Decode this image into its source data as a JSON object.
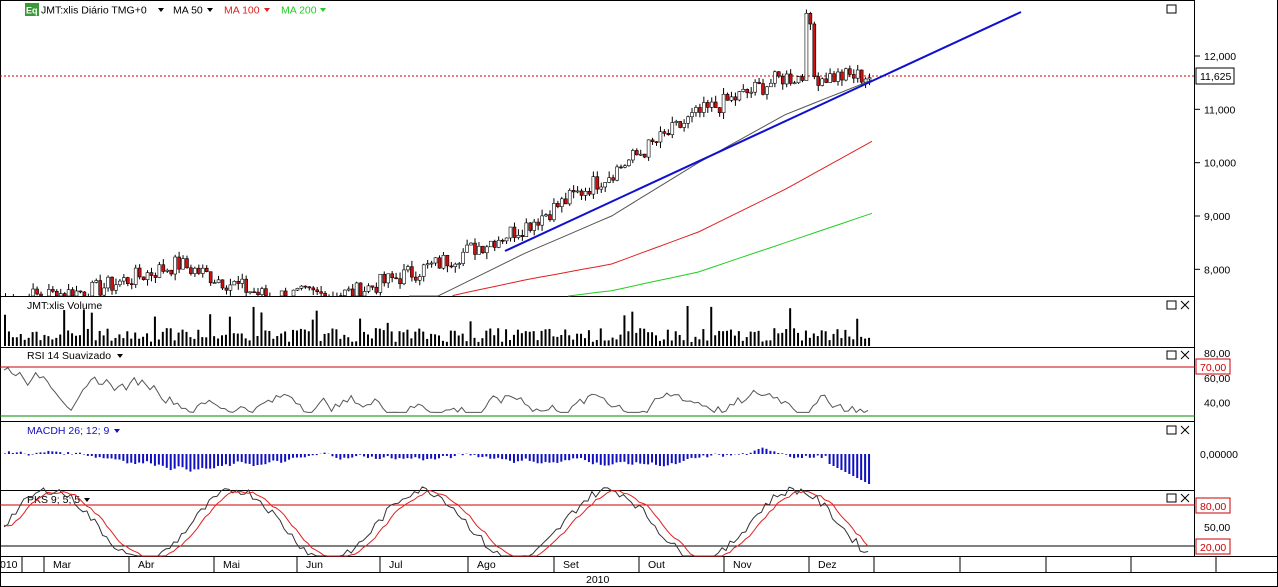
{
  "header": {
    "logo": "Eq",
    "symbol_label": "JMT:xlis Diário TMG+0",
    "ma50_label": "MA 50",
    "ma100_label": "MA 100",
    "ma200_label": "MA 200",
    "dropdown_icon": "triangle-down-icon"
  },
  "colors": {
    "ma50": "#555555",
    "ma100": "#e02020",
    "ma200": "#22cc22",
    "trendline": "#1010d0",
    "price_line": "#cc0000",
    "macd": "#1010c0",
    "rsi": "#555555",
    "rsi_level_high": "#cc0000",
    "rsi_level_low": "#008800",
    "candle_up": "#ffffff",
    "candle_down": "#d01010"
  },
  "panels": {
    "price": {
      "current_price_label": "11,625",
      "current_price": 11.625
    },
    "volume": {
      "label": "JMT:xlis Volume"
    },
    "rsi": {
      "label": "RSI 14 Suavizado",
      "level_high_label": "70,00",
      "level_high": 70,
      "level_low": 30
    },
    "macd": {
      "label": "MACDH 26; 12; 9"
    },
    "pks": {
      "label": "PKS 9; 5; 5",
      "level_high_label": "80,00",
      "level_low_label": "20,00"
    }
  },
  "chart_data": [
    {
      "type": "candlestick",
      "yticks": [
        "8,000",
        "9,000",
        "10,000",
        "11,000",
        "12,000"
      ],
      "yvalues": [
        8,
        9,
        10,
        11,
        12
      ],
      "ylim": [
        7.5,
        13.05
      ],
      "x": [
        "2010",
        "Mar",
        "Abr",
        "Mai",
        "Jun",
        "Jul",
        "Ago",
        "Set",
        "Out",
        "Nov",
        "Dez"
      ],
      "x_year_label": "2010",
      "close_by_month": [
        7.45,
        7.6,
        8.1,
        7.5,
        7.55,
        8.1,
        8.8,
        9.8,
        10.9,
        11.6,
        11.625
      ],
      "series": [
        {
          "name": "MA 50",
          "values": [
            7.3,
            7.35,
            7.6,
            7.6,
            7.5,
            7.5,
            8.3,
            9.0,
            10.0,
            10.9,
            11.55
          ]
        },
        {
          "name": "MA 100",
          "values": [
            7.2,
            7.25,
            7.35,
            7.4,
            7.42,
            7.45,
            7.8,
            8.1,
            8.7,
            9.5,
            10.4
          ]
        },
        {
          "name": "MA 200",
          "values": [
            7.1,
            7.15,
            7.2,
            7.25,
            7.28,
            7.3,
            7.4,
            7.6,
            7.95,
            8.5,
            9.05
          ]
        }
      ]
    },
    {
      "type": "bar",
      "name": "JMT:xlis Volume"
    },
    {
      "type": "line",
      "name": "RSI 14 Suavizado",
      "yticks": [
        "40,00",
        "60,00",
        "80,00"
      ],
      "ylim": [
        25,
        85
      ]
    },
    {
      "type": "bar",
      "name": "MACDH 26; 12; 9",
      "yticks": [
        "0,00000"
      ]
    },
    {
      "type": "line",
      "name": "PKS 9; 5; 5",
      "yticks": [
        "50,00",
        "20,00",
        "80,00"
      ],
      "ylim": [
        15,
        90
      ]
    }
  ]
}
